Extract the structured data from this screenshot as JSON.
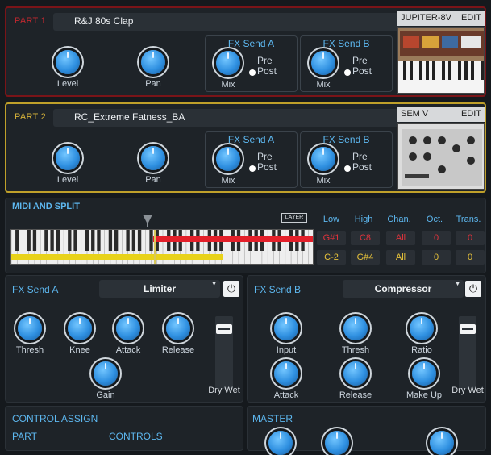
{
  "part1": {
    "title": "PART 1",
    "preset": "R&J 80s Clap",
    "synth_name": "JUPITER-8V",
    "edit_label": "EDIT",
    "level_label": "Level",
    "pan_label": "Pan",
    "fx_a": {
      "title": "FX Send A",
      "mix_label": "Mix",
      "pre_label": "Pre",
      "post_label": "Post"
    },
    "fx_b": {
      "title": "FX Send B",
      "mix_label": "Mix",
      "pre_label": "Pre",
      "post_label": "Post"
    }
  },
  "part2": {
    "title": "PART 2",
    "preset": "RC_Extreme Fatness_BA",
    "synth_name": "SEM V",
    "edit_label": "EDIT",
    "level_label": "Level",
    "pan_label": "Pan",
    "fx_a": {
      "title": "FX Send A",
      "mix_label": "Mix",
      "pre_label": "Pre",
      "post_label": "Post"
    },
    "fx_b": {
      "title": "FX Send B",
      "mix_label": "Mix",
      "pre_label": "Pre",
      "post_label": "Post"
    }
  },
  "midi": {
    "title": "MIDI AND SPLIT",
    "layer_label": "LAYER",
    "headers": [
      "Low",
      "High",
      "Chan.",
      "Oct.",
      "Trans."
    ],
    "row1": [
      "G#1",
      "C8",
      "All",
      "0",
      "0"
    ],
    "row2": [
      "C-2",
      "G#4",
      "All",
      "0",
      "0"
    ]
  },
  "fx_send_a": {
    "title": "FX Send A",
    "effect": "Limiter",
    "knobs": [
      "Thresh",
      "Knee",
      "Attack",
      "Release",
      "Gain"
    ],
    "drywet_label": "Dry Wet"
  },
  "fx_send_b": {
    "title": "FX Send B",
    "effect": "Compressor",
    "knobs": [
      "Input",
      "Thresh",
      "Ratio",
      "Attack",
      "Release",
      "Make Up"
    ],
    "drywet_label": "Dry Wet"
  },
  "control_assign": {
    "title": "CONTROL ASSIGN",
    "part_label": "PART",
    "controls_label": "CONTROLS"
  },
  "master": {
    "title": "MASTER"
  },
  "colors": {
    "part1_border": "#7a1418",
    "part2_border": "#bfa02a",
    "accent": "#5db7ef",
    "knob": "#2e8fe0"
  }
}
